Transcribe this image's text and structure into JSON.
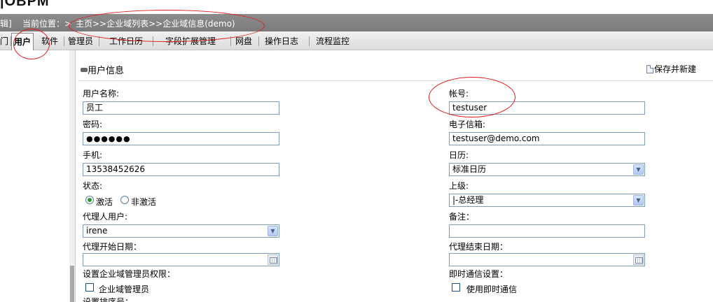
{
  "app": {
    "logo_text": "|OBPM"
  },
  "breadcrumb": {
    "edge_text": "辑]",
    "label": "当前位置：>",
    "path": "主页>>企业域列表>>企业域信息(demo)"
  },
  "tabs": [
    {
      "label": "门"
    },
    {
      "label": "用户"
    },
    {
      "label": "软件"
    },
    {
      "label": "管理员"
    },
    {
      "label": "工作日历"
    },
    {
      "label": "字段扩展管理"
    },
    {
      "label": "网盘"
    },
    {
      "label": "操作日志"
    },
    {
      "label": "流程监控"
    }
  ],
  "section": {
    "title": "用户信息",
    "save_new_label": "保存并新建"
  },
  "form": {
    "username": {
      "label": "用户名称:",
      "value": "员工"
    },
    "account": {
      "label": "帐号:",
      "value": "testuser"
    },
    "password": {
      "label": "密码:",
      "value": "●●●●●●"
    },
    "email": {
      "label": "电子信箱:",
      "value": "testuser@demo.com"
    },
    "mobile": {
      "label": "手机:",
      "value": "13538452626"
    },
    "calendar": {
      "label": "日历:",
      "value": "标准日历"
    },
    "status": {
      "label": "状态:",
      "option_active": "激活",
      "option_inactive": "非激活",
      "selected": "激活"
    },
    "superior": {
      "label": "上级:",
      "value": "|-总经理"
    },
    "proxy_user": {
      "label": "代理人用户:",
      "value": "irene"
    },
    "remark": {
      "label": "备注：",
      "value": ""
    },
    "proxy_start": {
      "label": "代理开始日期：",
      "value": ""
    },
    "proxy_end": {
      "label": "代理结束日期：",
      "value": ""
    },
    "admin_perm": {
      "label": "设置企业域管理员权限：",
      "checkbox_label": "企业域管理员",
      "checked": false
    },
    "im": {
      "label": "即时通信设置：",
      "checkbox_label": "使用即时通信",
      "checked": false
    },
    "sort_label": "设置排序号："
  },
  "icons": {
    "arrow": "▼",
    "section": "minus-icon",
    "save": "save-document-icon",
    "calendar": "calendar-icon"
  },
  "colors": {
    "breadcrumb_bg": "#858585",
    "annotation": "#e01a1a",
    "input_border": "#7f9db9"
  }
}
